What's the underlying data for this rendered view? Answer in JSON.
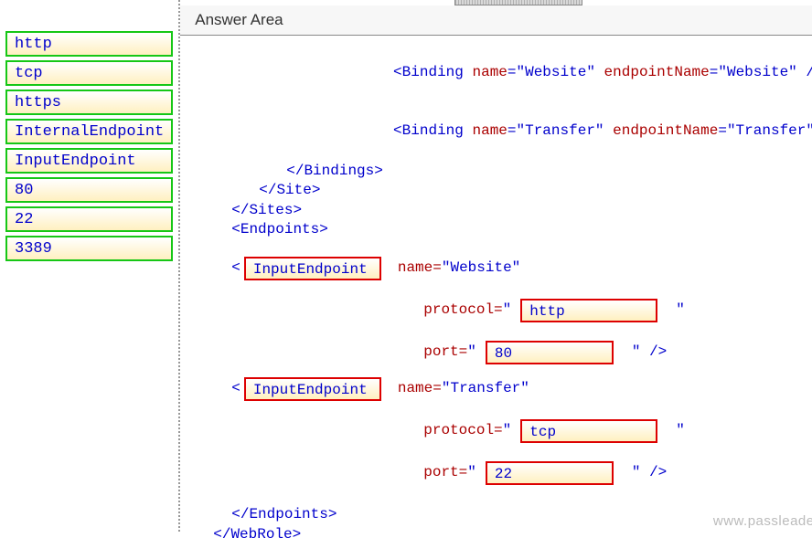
{
  "header": "Answer Area",
  "choices": [
    "http",
    "tcp",
    "https",
    "InternalEndpoint",
    "InputEndpoint",
    "80",
    "22",
    "3389"
  ],
  "code": {
    "binding1_attr_name": "name",
    "binding1_val_name": "\"Website\"",
    "binding1_attr_ep": "endpointName",
    "binding1_val_ep": "\"Website\"",
    "binding2_attr_name": "name",
    "binding2_val_name": "\"Transfer\"",
    "binding2_attr_ep": "endpointName",
    "binding2_val_ep": "\"Transfer\"",
    "close_bindings": "</Bindings>",
    "close_site": "</Site>",
    "close_sites": "</Sites>",
    "open_endpoints": "<Endpoints>",
    "ep1": {
      "type": "InputEndpoint",
      "name_label": "name=",
      "name_val": "\"Website\"",
      "proto_label": "protocol=",
      "proto_val": "http",
      "port_label": "port=",
      "port_val": "80"
    },
    "ep2": {
      "type": "InputEndpoint",
      "name_label": "name=",
      "name_val": "\"Transfer\"",
      "proto_label": "protocol=",
      "proto_val": "tcp",
      "port_label": "port=",
      "port_val": "22"
    },
    "close_endpoints": "</Endpoints>",
    "close_webrole": "</WebRole>"
  },
  "watermark": "www.passleader.com"
}
